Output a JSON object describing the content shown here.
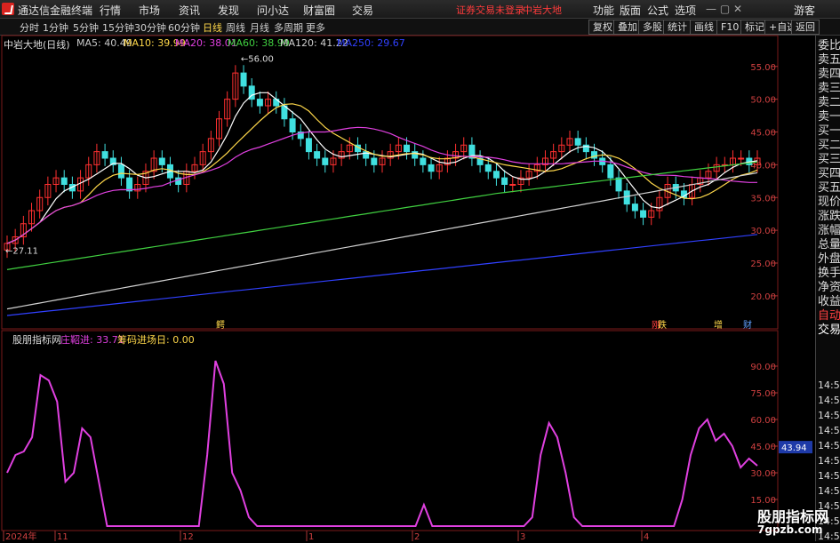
{
  "app": {
    "title": "通达信金融终端",
    "menu": [
      "行情",
      "市场",
      "资讯",
      "发现",
      "问小达",
      "财富圈",
      "交易"
    ],
    "login_status": "证券交易未登录",
    "stock_name_top": "中岩大地",
    "right_menu": [
      "功能",
      "版面",
      "公式",
      "选项"
    ],
    "user": "游客"
  },
  "toolbar": {
    "periods": [
      "分时",
      "1分钟",
      "5分钟",
      "15分钟",
      "30分钟",
      "60分钟",
      "日线",
      "周线",
      "月线",
      "多周期",
      "更多"
    ],
    "active_period": "日线",
    "buttons": [
      "复权",
      "叠加",
      "多股",
      "统计",
      "画线",
      "F10",
      "标记",
      "+自选",
      "返回"
    ]
  },
  "chart": {
    "title": "中岩大地(日线)",
    "ma": [
      {
        "label": "MA5: 40.49",
        "color": "#ffffff"
      },
      {
        "label": "MA10: 39.99",
        "color": "#ffd84a"
      },
      {
        "label": "MA20: 38.01",
        "color": "#e040e0"
      },
      {
        "label": "MA60: 38.99",
        "color": "#40d040"
      },
      {
        "label": "MA120: 41.22",
        "color": "#d0d0d0"
      },
      {
        "label": "MA250: 29.67",
        "color": "#3040ff"
      }
    ],
    "high_label": "56.00",
    "low_label": "27.11",
    "price_ticks": [
      "55.00",
      "50.00",
      "45.00",
      "40.00",
      "35.00",
      "30.00",
      "25.00",
      "20.00"
    ],
    "x_labels": [
      "2024年",
      "11",
      "12",
      "1",
      "2",
      "3",
      "4"
    ],
    "markers": [
      {
        "text": "鳄",
        "color": "#ffd84a"
      },
      {
        "text": "刚",
        "color": "#ff4040"
      },
      {
        "text": "跌",
        "color": "#ffd84a"
      },
      {
        "text": "增",
        "color": "#ffd84a"
      },
      {
        "text": "财",
        "color": "#60a0ff"
      }
    ]
  },
  "indicator": {
    "name": "股朋指标网",
    "line1": "庄鞀进: 33.71",
    "line2": "筹码进场日: 0.00",
    "ticks": [
      "90.00",
      "75.00",
      "60.00",
      "45.00",
      "30.00",
      "15.00"
    ],
    "current": "43.94",
    "color": "#e040e0"
  },
  "sidetabs": [
    "委比",
    "卖五",
    "卖四",
    "卖三",
    "卖二",
    "卖一",
    "买一",
    "买二",
    "买三",
    "买四",
    "买五",
    "现价",
    "涨跌",
    "涨幅",
    "总量",
    "外盘",
    "换手",
    "净资",
    "收益",
    "自动",
    "交易"
  ],
  "side_times": [
    "14:56",
    "14:56",
    "14:56",
    "14:56",
    "14:56",
    "14:56",
    "14:56",
    "14:56",
    "14:56",
    "14:56",
    "14:56"
  ],
  "watermark": {
    "main": "股朋指标网",
    "url": "7gpzb.com"
  },
  "chart_data": {
    "type": "line",
    "title": "中岩大地(日线)",
    "ylim": [
      17,
      57
    ],
    "candles_close": [
      28,
      29,
      31,
      33,
      35,
      37,
      38,
      37,
      36,
      38,
      40,
      42,
      41,
      40,
      38,
      36,
      37,
      39,
      41,
      40,
      38,
      37,
      39,
      40,
      42,
      44,
      47,
      50,
      54,
      52,
      50,
      49,
      50,
      49,
      47,
      45,
      44,
      42,
      41,
      40,
      41,
      42,
      43,
      42,
      41,
      40,
      41,
      42,
      43,
      42,
      41,
      40,
      39,
      40,
      41,
      42,
      43,
      41,
      40,
      39,
      38,
      37,
      37,
      38,
      39,
      40,
      41,
      42,
      43,
      44,
      43,
      42,
      41,
      40,
      38,
      36,
      34,
      33,
      32,
      33,
      35,
      37,
      36,
      35,
      37,
      38,
      39,
      40,
      40,
      41,
      41,
      40,
      41
    ],
    "indicator_values": [
      30,
      40,
      42,
      50,
      85,
      82,
      70,
      25,
      30,
      55,
      50,
      25,
      0,
      0,
      0,
      0,
      0,
      0,
      0,
      0,
      0,
      0,
      0,
      0,
      40,
      93,
      80,
      30,
      20,
      5,
      0,
      0,
      0,
      0,
      0,
      0,
      0,
      0,
      0,
      0,
      0,
      0,
      0,
      0,
      0,
      0,
      0,
      0,
      0,
      0,
      12,
      0,
      0,
      0,
      0,
      0,
      0,
      0,
      0,
      0,
      0,
      0,
      0,
      5,
      40,
      58,
      50,
      30,
      5,
      0,
      0,
      0,
      0,
      0,
      0,
      0,
      0,
      0,
      0,
      0,
      0,
      15,
      40,
      55,
      60,
      48,
      52,
      45,
      33,
      38,
      34
    ]
  }
}
